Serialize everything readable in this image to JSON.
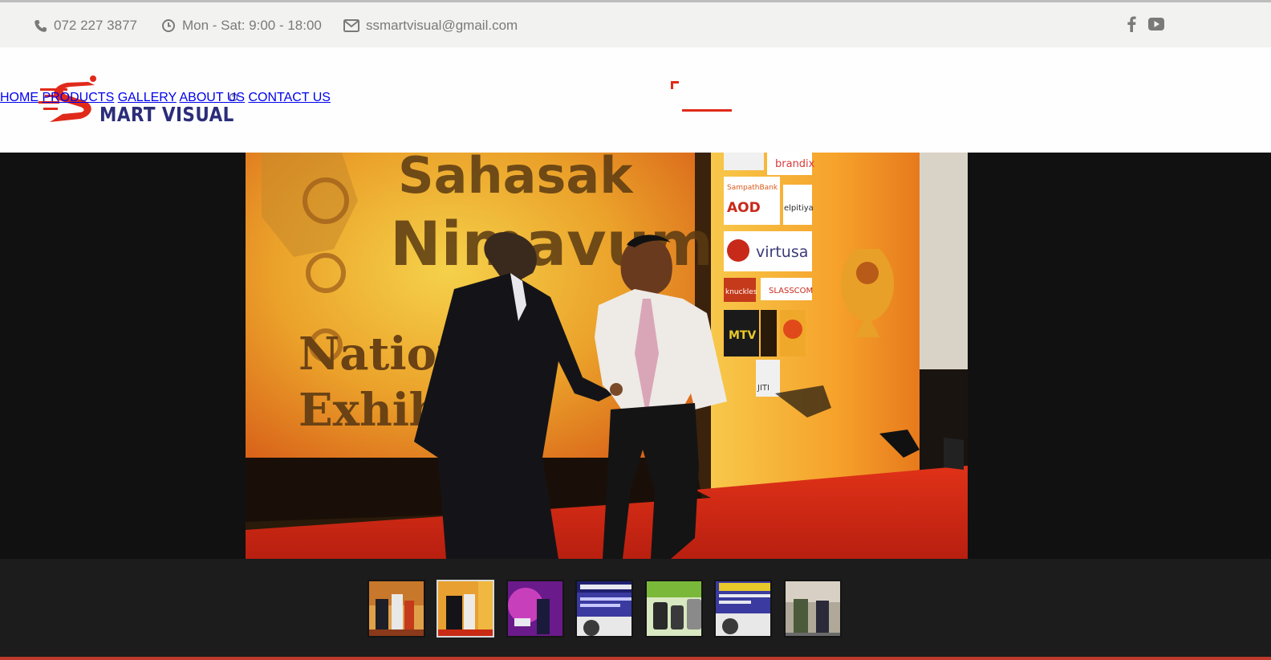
{
  "topbar": {
    "phone": "072 227 3877",
    "hours": "Mon - Sat: 9:00 - 18:00",
    "email": "ssmartvisual@gmail.com",
    "social": [
      "facebook-icon",
      "youtube-icon"
    ]
  },
  "logo": {
    "text": "MART VISUAL",
    "registered": "®"
  },
  "nav": {
    "items": [
      {
        "label": "HOME",
        "active": true
      },
      {
        "label": "PRODUCTS",
        "active": false
      },
      {
        "label": "GALLERY",
        "active": false
      },
      {
        "label": "ABOUT US",
        "active": false
      },
      {
        "label": "CONTACT US",
        "active": false
      }
    ]
  },
  "slider": {
    "banner_lines": [
      "Sahasak",
      "Nimavum",
      "Nation",
      "Exhibi"
    ],
    "sponsors": [
      "brandix",
      "SampathBank",
      "AOD",
      "elpitiya",
      "virtusa",
      "knuckles",
      "SLASSCOM",
      "MTV",
      "JITI"
    ],
    "thumbnail_count": 7,
    "active_thumbnail": 2
  },
  "colors": {
    "accent": "#e02a1a",
    "brand_blue": "#2b2d7a",
    "nav_text": "#8a8a8a",
    "topbar_bg": "#f2f2f0",
    "slider_bg": "#111111"
  }
}
